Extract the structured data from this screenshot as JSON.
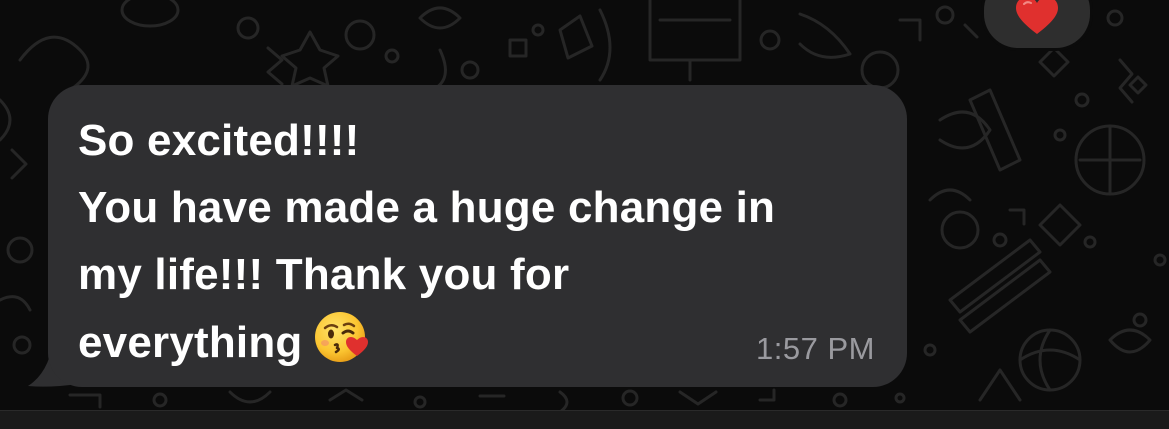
{
  "message": {
    "lines": [
      "So excited!!!!",
      "You have made a huge change in",
      "my life!!! Thank you for",
      "everything"
    ],
    "emoji": "kissing-face-with-heart",
    "timestamp": "1:57 PM",
    "direction": "incoming"
  },
  "reaction": {
    "emoji": "red-heart"
  },
  "colors": {
    "background": "#0b0b0b",
    "bubble": "#2f2f31",
    "text": "#ffffff",
    "timestamp": "#9a9a9f",
    "heart": "#e0302e",
    "doodle": "#262626"
  }
}
